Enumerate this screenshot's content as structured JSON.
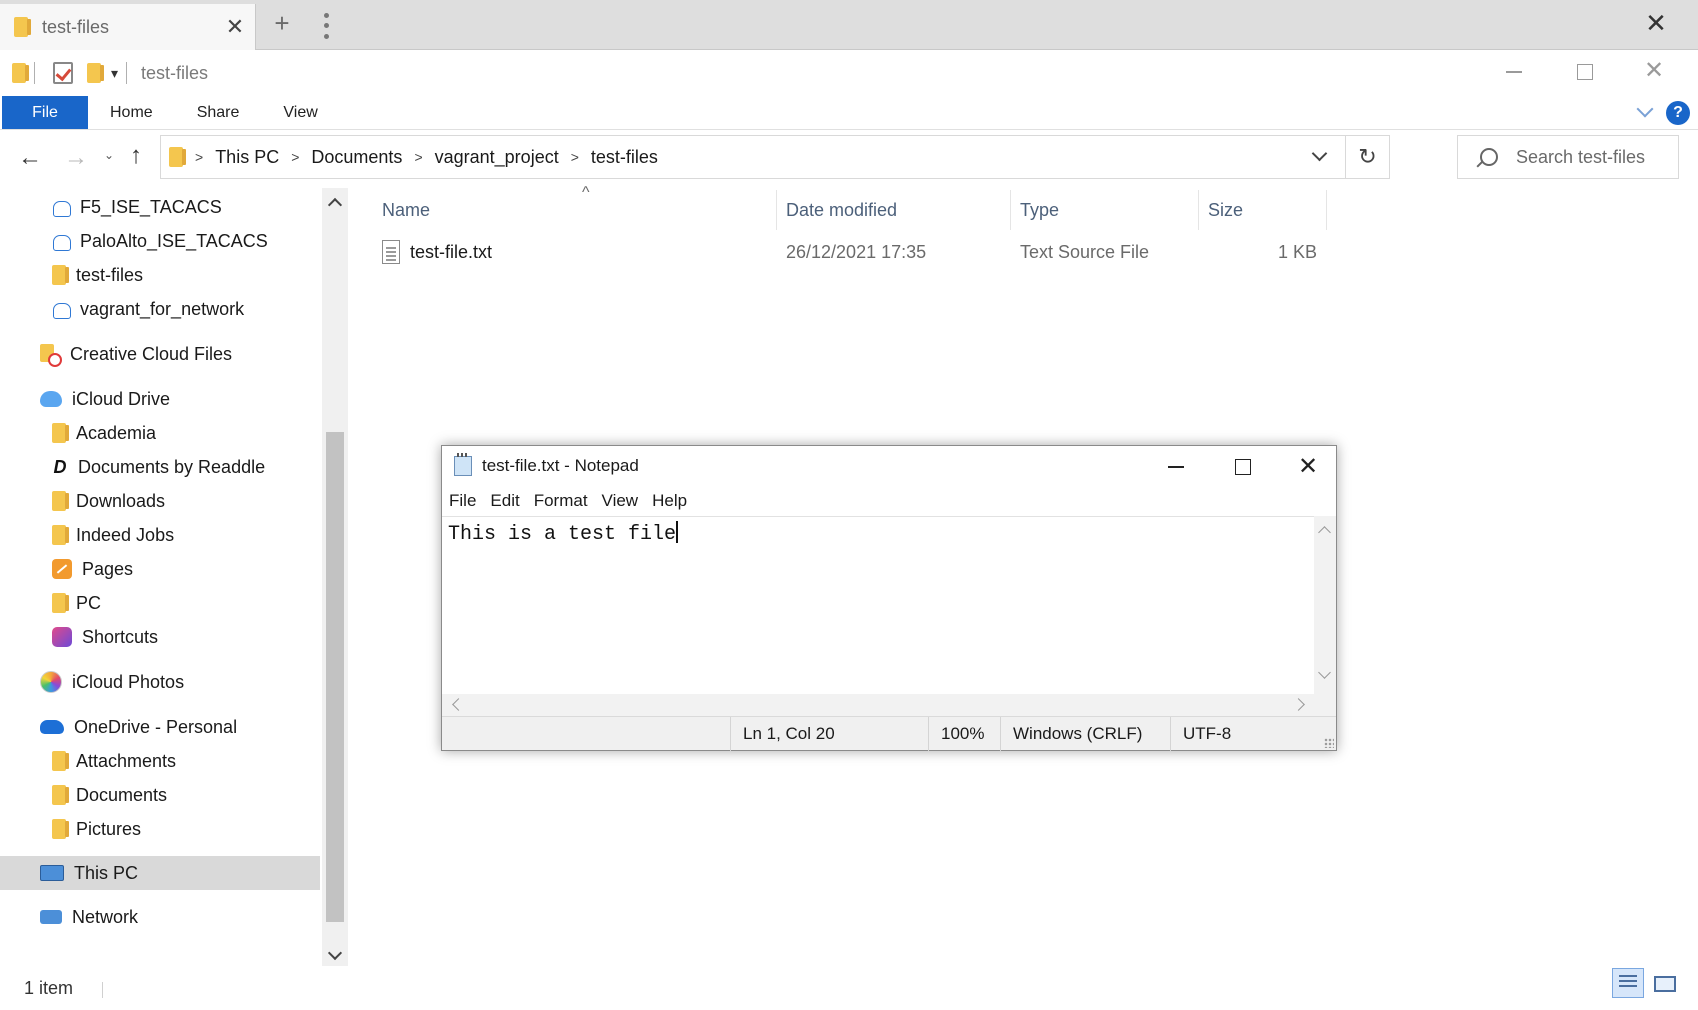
{
  "tab": {
    "title": "test-files",
    "close": "✕",
    "new": "+"
  },
  "window": {
    "title": "test-files",
    "close_top": "✕",
    "close": "✕"
  },
  "ribbon": {
    "tabs": [
      "File",
      "Home",
      "Share",
      "View"
    ],
    "help": "?"
  },
  "nav": {
    "back": "←",
    "forward": "→",
    "recent": "⌄",
    "up": "↑",
    "refresh": "↻",
    "breadcrumb": [
      "This PC",
      "Documents",
      "vagrant_project",
      "test-files"
    ],
    "search_placeholder": "Search test-files"
  },
  "navpane": {
    "items": [
      {
        "label": "F5_ISE_TACACS",
        "icon": "cloud-folder-icon"
      },
      {
        "label": "PaloAlto_ISE_TACACS",
        "icon": "cloud-folder-icon"
      },
      {
        "label": "test-files",
        "icon": "folder-icon"
      },
      {
        "label": "vagrant_for_network",
        "icon": "cloud-folder-icon"
      },
      {
        "label": "Creative Cloud Files",
        "icon": "creative-cloud-icon"
      },
      {
        "label": "iCloud Drive",
        "icon": "icloud-icon"
      },
      {
        "label": "Academia",
        "icon": "folder-icon"
      },
      {
        "label": "Documents by Readdle",
        "icon": "readdle-icon"
      },
      {
        "label": "Downloads",
        "icon": "folder-icon"
      },
      {
        "label": "Indeed Jobs",
        "icon": "folder-icon"
      },
      {
        "label": "Pages",
        "icon": "pages-icon"
      },
      {
        "label": "PC",
        "icon": "folder-icon"
      },
      {
        "label": "Shortcuts",
        "icon": "shortcuts-icon"
      },
      {
        "label": "iCloud Photos",
        "icon": "photos-icon"
      },
      {
        "label": "OneDrive - Personal",
        "icon": "onedrive-icon"
      },
      {
        "label": "Attachments",
        "icon": "folder-icon"
      },
      {
        "label": "Documents",
        "icon": "folder-icon"
      },
      {
        "label": "Pictures",
        "icon": "folder-icon"
      },
      {
        "label": "This PC",
        "icon": "pc-icon",
        "selected": true
      },
      {
        "label": "Network",
        "icon": "network-icon"
      }
    ]
  },
  "filelist": {
    "columns": [
      "Name",
      "Date modified",
      "Type",
      "Size"
    ],
    "sort_indicator": "^",
    "rows": [
      {
        "name": "test-file.txt",
        "date": "26/12/2021 17:35",
        "type": "Text Source File",
        "size": "1 KB"
      }
    ]
  },
  "status": {
    "text": "1 item"
  },
  "notepad": {
    "title": "test-file.txt - Notepad",
    "close": "✕",
    "menu": [
      "File",
      "Edit",
      "Format",
      "View",
      "Help"
    ],
    "content": "This is a test file",
    "status": {
      "position": "Ln 1, Col 20",
      "zoom": "100%",
      "line_ending": "Windows (CRLF)",
      "encoding": "UTF-8"
    }
  }
}
